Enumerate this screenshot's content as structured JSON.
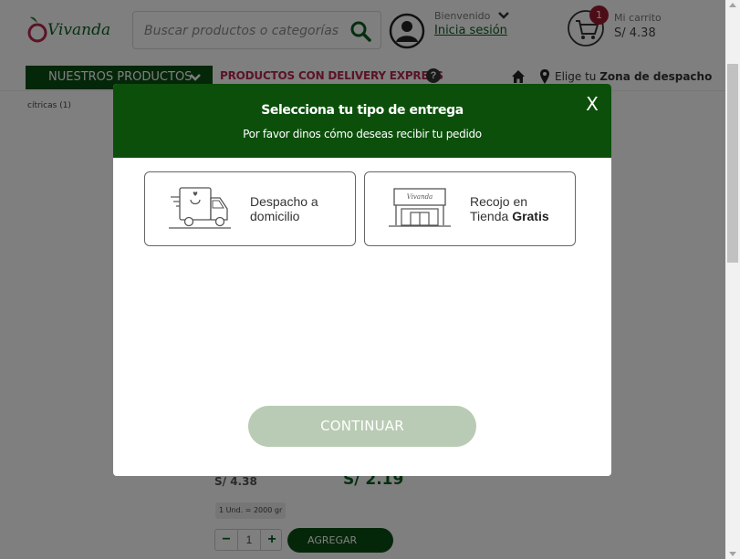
{
  "header": {
    "logo_text": "Vivanda",
    "search_placeholder": "Buscar productos o categorías",
    "welcome": "Bienvenido",
    "login_link": "Inicia sesión",
    "cart_count": "1",
    "cart_label": "Mi carrito",
    "cart_total": "S/ 4.38"
  },
  "nav": {
    "products": "NUESTROS PRODUCTOS",
    "express": "PRODUCTOS CON DELIVERY EXPRESS",
    "zone_prefix": "Elige tu",
    "zone_bold": "Zona de despacho"
  },
  "sidebar": {
    "filter_item": "cítricas (1)"
  },
  "product": {
    "old_price": "S/ 4.38",
    "price": "S/ 2.19",
    "unit": "1 Und. = 2000 gr",
    "qty": "1",
    "minus": "−",
    "plus": "+",
    "add_label": "AGREGAR"
  },
  "modal": {
    "title": "Selecciona tu tipo de entrega",
    "subtitle": "Por favor dinos cómo deseas recibir tu pedido",
    "close": "X",
    "option_home_line1": "Despacho a",
    "option_home_line2": "domicilio",
    "option_store_line1": "Recojo en",
    "option_store_line2a": "Tienda",
    "option_store_line2b": "Gratis",
    "store_sign": "Vivanda",
    "continue": "CONTINUAR"
  },
  "colors": {
    "brand_green": "#0b4f0b",
    "express_pink": "#b5284d",
    "badge_red": "#9b1b2e",
    "continue_disabled": "#b9cbb4"
  },
  "icons": [
    "logo-apple-icon",
    "search-icon",
    "avatar-icon",
    "chevron-down-icon",
    "cart-icon",
    "help-icon",
    "home-icon",
    "location-pin-icon",
    "delivery-truck-icon",
    "store-icon",
    "close-icon"
  ]
}
